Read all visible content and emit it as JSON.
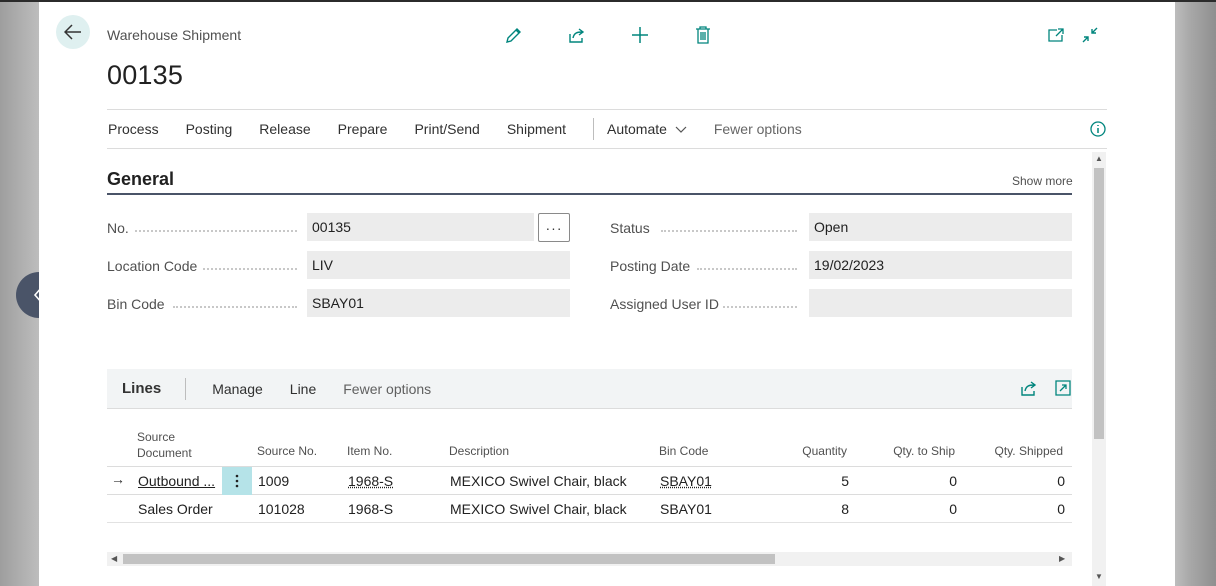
{
  "header": {
    "breadcrumb": "Warehouse Shipment",
    "doc_number": "00135"
  },
  "top_actions": [
    "edit-icon",
    "share-icon",
    "new-icon",
    "delete-icon"
  ],
  "window_actions": [
    "open-new-window-icon",
    "collapse-icon"
  ],
  "actionbar": {
    "items": [
      "Process",
      "Posting",
      "Release",
      "Prepare",
      "Print/Send",
      "Shipment"
    ],
    "automate": "Automate",
    "fewer_options": "Fewer options"
  },
  "general": {
    "title": "General",
    "show_more": "Show more",
    "fields": {
      "no_label": "No.",
      "no_value": "00135",
      "location_label": "Location Code",
      "location_value": "LIV",
      "bin_label": "Bin Code",
      "bin_value": "SBAY01",
      "status_label": "Status",
      "status_value": "Open",
      "posting_date_label": "Posting Date",
      "posting_date_value": "19/02/2023",
      "assigned_user_label": "Assigned User ID",
      "assigned_user_value": ""
    },
    "ellipsis": "···"
  },
  "lines": {
    "title": "Lines",
    "actions": [
      "Manage",
      "Line"
    ],
    "fewer_options": "Fewer options",
    "columns": {
      "source_doc_1": "Source",
      "source_doc_2": "Document",
      "source_no": "Source No.",
      "item_no": "Item No.",
      "description": "Description",
      "bin_code": "Bin Code",
      "quantity": "Quantity",
      "qty_to_ship": "Qty. to Ship",
      "qty_shipped": "Qty. Shipped"
    },
    "rows": [
      {
        "source_document": "Outbound ...",
        "source_no": "1009",
        "item_no": "1968-S",
        "description": "MEXICO Swivel Chair, black",
        "bin_code": "SBAY01",
        "quantity": "5",
        "qty_to_ship": "0",
        "qty_shipped": "0"
      },
      {
        "source_document": "Sales Order",
        "source_no": "101028",
        "item_no": "1968-S",
        "description": "MEXICO Swivel Chair, black",
        "bin_code": "SBAY01",
        "quantity": "8",
        "qty_to_ship": "0",
        "qty_shipped": "0"
      }
    ]
  },
  "colors": {
    "accent": "#00857d",
    "row_selected": "#b5e3e8",
    "nav_button": "#4a5468"
  }
}
